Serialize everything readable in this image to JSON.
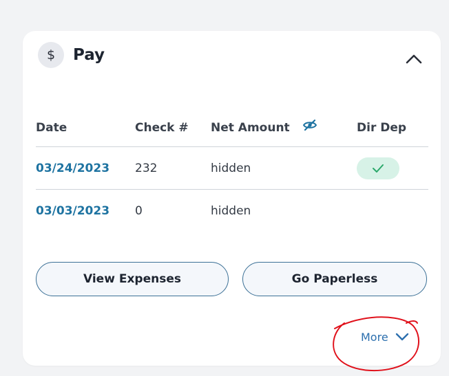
{
  "card": {
    "title": "Pay",
    "dollar_symbol": "$",
    "header_icon": "dollar-icon",
    "collapse_icon": "chevron-up-icon"
  },
  "table": {
    "headers": {
      "date": "Date",
      "check": "Check #",
      "net_amount": "Net Amount",
      "dir_dep": "Dir Dep"
    },
    "net_amount_icon": "eye-slash-icon",
    "rows": [
      {
        "date": "03/24/2023",
        "check": "232",
        "net_amount": "hidden",
        "dir_dep": true
      },
      {
        "date": "03/03/2023",
        "check": "0",
        "net_amount": "hidden",
        "dir_dep": false
      }
    ]
  },
  "buttons": {
    "view_expenses": "View Expenses",
    "go_paperless": "Go Paperless"
  },
  "more": {
    "label": "More",
    "icon": "chevron-down-icon"
  },
  "colors": {
    "link": "#1e73a1",
    "accent_blue": "#2c6fae",
    "check_green": "#2aa86a",
    "pill_bg": "#d7f2e7",
    "annotation_red": "#e0101a"
  }
}
